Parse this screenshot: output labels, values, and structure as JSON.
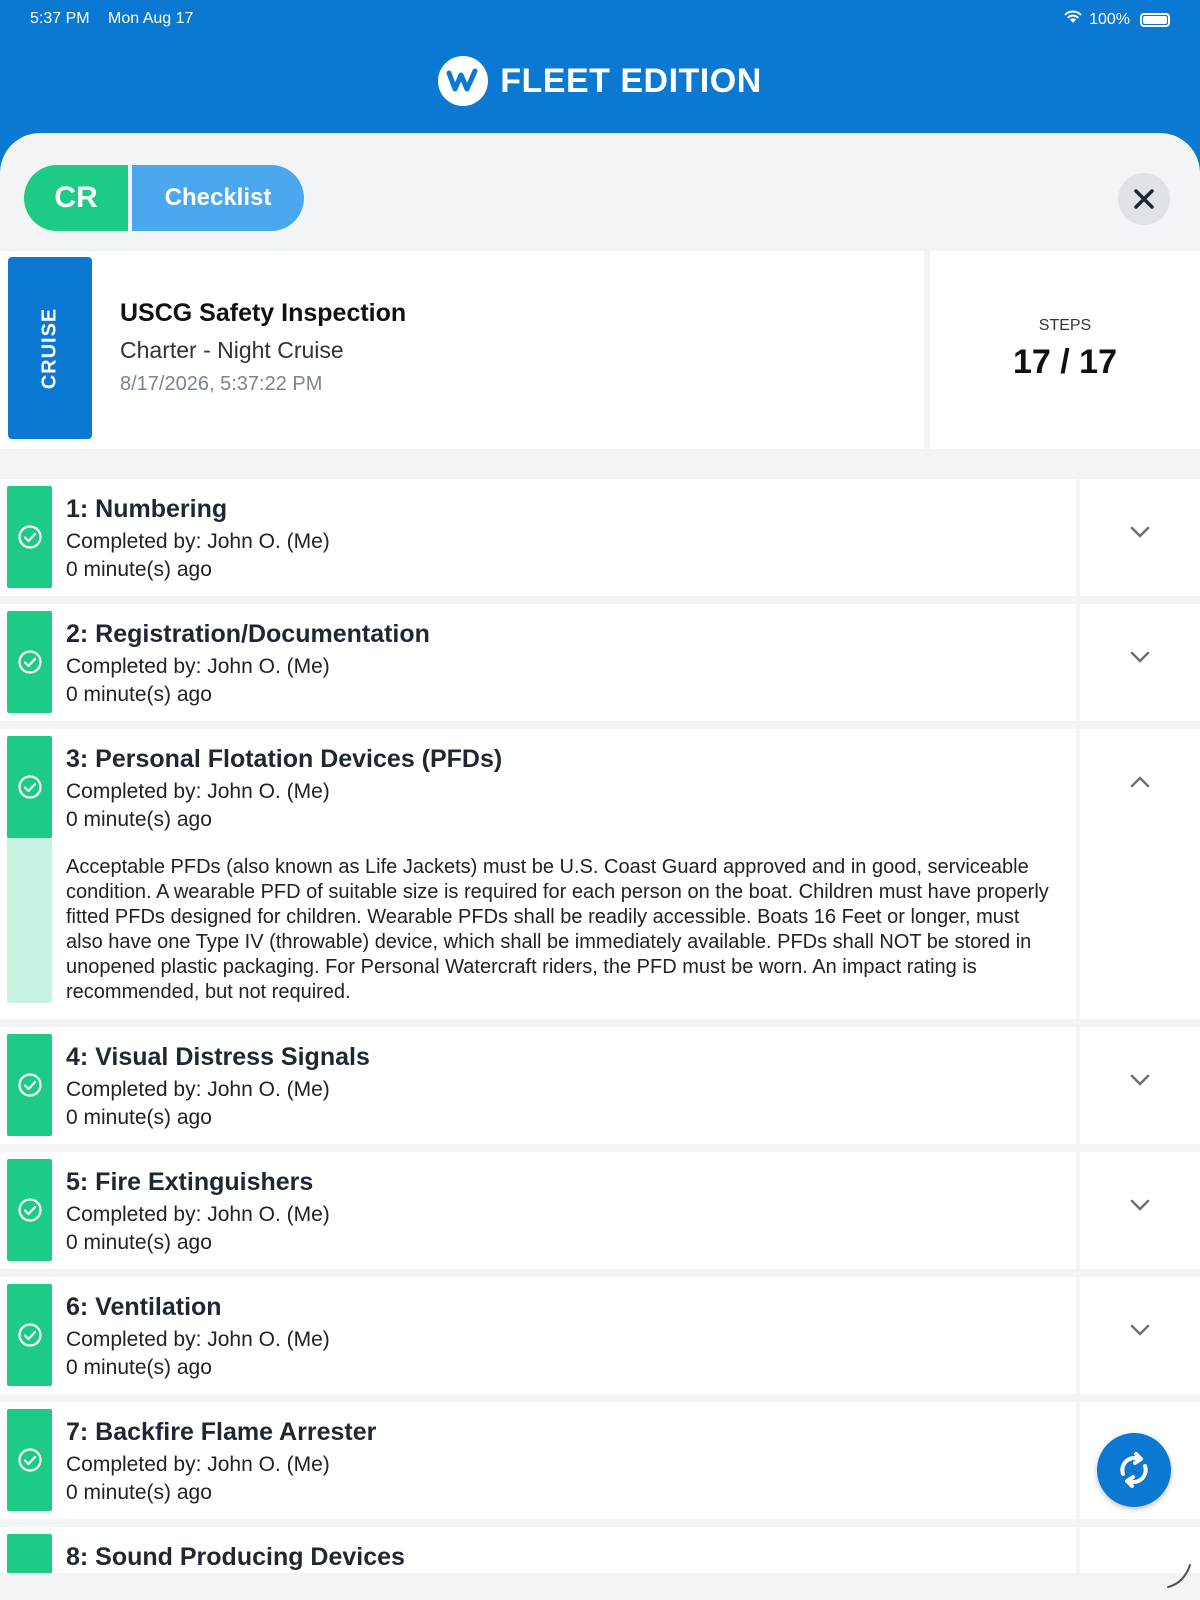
{
  "status_bar": {
    "time": "5:37 PM",
    "date": "Mon Aug 17",
    "battery": "100%"
  },
  "brand": {
    "title": "FLEET EDITION"
  },
  "tabs": {
    "cr_label": "CR",
    "checklist_label": "Checklist"
  },
  "summary": {
    "tag": "CRUISE",
    "title": "USCG Safety Inspection",
    "subtitle": "Charter - Night Cruise",
    "datetime": "8/17/2026, 5:37:22 PM",
    "steps_label": "STEPS",
    "steps_value": "17 / 17"
  },
  "colors": {
    "brand_blue": "#0b78d1",
    "complete_green": "#1dcb87",
    "checklist_blue": "#4ca8ee"
  },
  "steps": [
    {
      "title": "1: Numbering",
      "completed_by": "Completed by: John O. (Me)",
      "time": "0 minute(s) ago",
      "expanded": false
    },
    {
      "title": "2: Registration/Documentation",
      "completed_by": "Completed by: John O. (Me)",
      "time": "0 minute(s) ago",
      "expanded": false
    },
    {
      "title": "3: Personal Flotation Devices (PFDs)",
      "completed_by": "Completed by: John O. (Me)",
      "time": "0 minute(s) ago",
      "expanded": true,
      "description": "Acceptable PFDs (also known as Life Jackets) must be U.S. Coast Guard approved and in good, serviceable condition. A wearable PFD of suitable size is required for each person on the boat. Children must have properly fitted PFDs designed for children. Wearable PFDs shall be readily accessible. Boats 16 Feet or longer, must also have one Type IV (throwable) device, which shall be immediately available. PFDs shall NOT be stored in unopened plastic packaging. For Personal Watercraft riders, the PFD must be worn. An impact rating is recommended, but not required."
    },
    {
      "title": "4: Visual Distress Signals",
      "completed_by": "Completed by: John O. (Me)",
      "time": "0 minute(s) ago",
      "expanded": false
    },
    {
      "title": "5: Fire Extinguishers",
      "completed_by": "Completed by: John O. (Me)",
      "time": "0 minute(s) ago",
      "expanded": false
    },
    {
      "title": "6: Ventilation",
      "completed_by": "Completed by: John O. (Me)",
      "time": "0 minute(s) ago",
      "expanded": false
    },
    {
      "title": "7: Backfire Flame Arrester",
      "completed_by": "Completed by: John O. (Me)",
      "time": "0 minute(s) ago",
      "expanded": false
    },
    {
      "title": "8: Sound Producing Devices",
      "completed_by": "",
      "time": "",
      "expanded": false
    }
  ]
}
